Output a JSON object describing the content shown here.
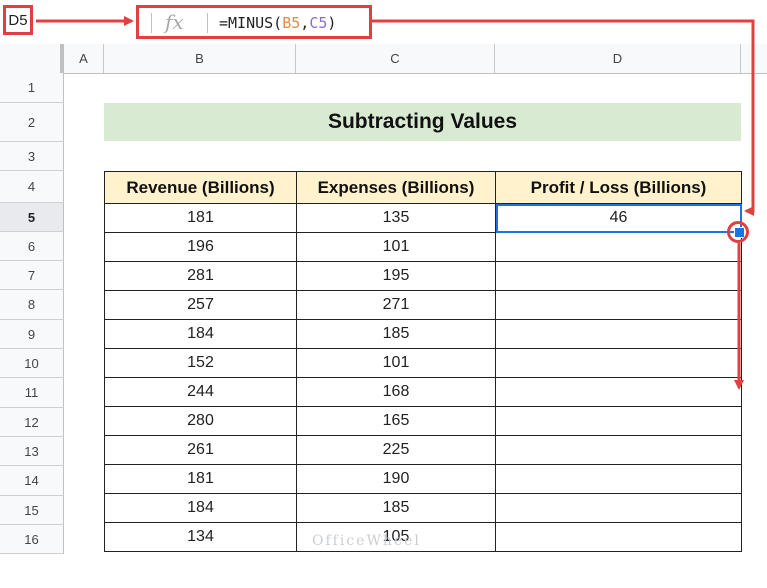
{
  "formula_bar": {
    "cell_ref": "D5",
    "fx_label": "fx",
    "formula_prefix": "=MINUS(",
    "formula_arg1": "B5",
    "formula_comma": ",",
    "formula_arg2": "C5",
    "formula_suffix": ")"
  },
  "columns": [
    "A",
    "B",
    "C",
    "D"
  ],
  "rows": [
    "1",
    "2",
    "3",
    "4",
    "5",
    "6",
    "7",
    "8",
    "9",
    "10",
    "11",
    "12",
    "13",
    "14",
    "15",
    "16"
  ],
  "title": "Subtracting Values",
  "table": {
    "headers": [
      "Revenue (Billions)",
      "Expenses (Billions)",
      "Profit / Loss (Billions)"
    ],
    "rows": [
      [
        "181",
        "135",
        "46"
      ],
      [
        "196",
        "101",
        ""
      ],
      [
        "281",
        "195",
        ""
      ],
      [
        "257",
        "271",
        ""
      ],
      [
        "184",
        "185",
        ""
      ],
      [
        "152",
        "101",
        ""
      ],
      [
        "244",
        "168",
        ""
      ],
      [
        "280",
        "165",
        ""
      ],
      [
        "261",
        "225",
        ""
      ],
      [
        "181",
        "190",
        ""
      ],
      [
        "184",
        "185",
        ""
      ],
      [
        "134",
        "105",
        ""
      ]
    ]
  },
  "watermark": "OfficeWheel",
  "colors": {
    "annotation_red": "#e04040",
    "title_fill": "#d9ead3",
    "header_fill": "#fff2cc",
    "selection_blue": "#1a73e8"
  }
}
